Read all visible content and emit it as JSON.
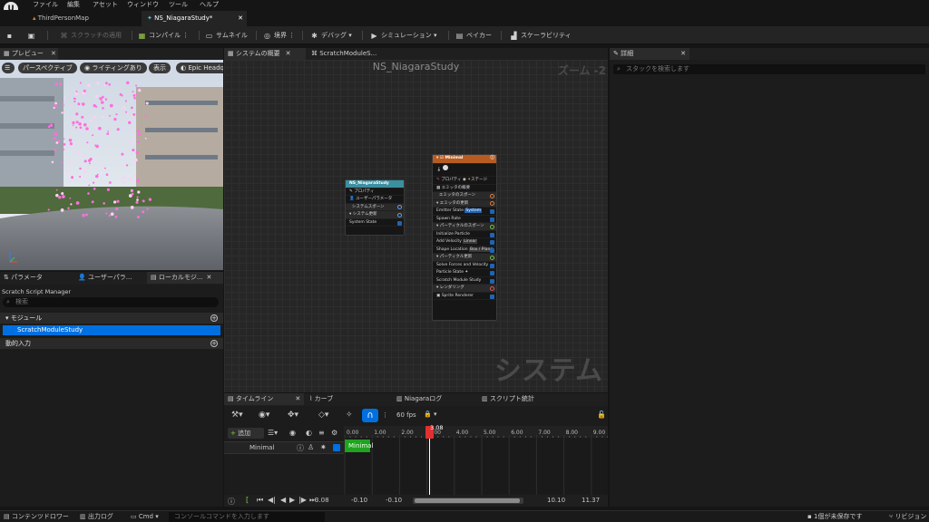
{
  "menu": [
    "ファイル",
    "編集",
    "アセット",
    "ウィンドウ",
    "ツール",
    "ヘルプ"
  ],
  "tabs": [
    {
      "label": "ThirdPersonMap"
    },
    {
      "label": "NS_NiagaraStudy*"
    }
  ],
  "toolbar": {
    "scratch": "スクラッチの適用",
    "compile": "コンパイル",
    "thumbnail": "サムネイル",
    "bounds": "境界",
    "debug": "デバッグ",
    "simulation": "シミュレーション",
    "baker": "ベイカー",
    "scalability": "スケーラビリティ"
  },
  "preview": {
    "tab": "プレビュー",
    "perspective": "パースペクティブ",
    "lighting": "ライティングあり",
    "show": "表示",
    "quality": "Epic Headq"
  },
  "graph_tabs": {
    "overview": "システムの概要",
    "scratch": "ScratchModuleS..."
  },
  "graph": {
    "title": "NS_NiagaraStudy",
    "zoom": "ズーム -2",
    "watermark": "システム",
    "system_node": {
      "title": "NS_NiagaraStudy",
      "rows": [
        "プロパティ",
        "ユーザーパラメータ",
        "システムスポーン",
        "システム更新",
        "System State"
      ]
    },
    "emitter_node": {
      "title": "Minimal",
      "header_props": "プロパティ",
      "header_stage": "ステージ",
      "rows": [
        "エミッタの概要",
        "エミッタのスポーン",
        "エミッタの更新",
        "Emitter State",
        "Spawn Rate",
        "パーティクルのスポーン",
        "Initialize Particle",
        "Add Velocity",
        "Shape Location",
        "パーティクル更新",
        "Solve Forces and Velocity",
        "Particle State",
        "Scratch Module Study",
        "レンダリング",
        "Sprite Renderer"
      ],
      "chips": {
        "system": "System",
        "linear": "Linear",
        "box": "Box / Plane"
      }
    }
  },
  "timeline": {
    "tabs": [
      "タイムライン",
      "カーブ",
      "Niagaraログ",
      "スクリプト統計"
    ],
    "fps": "60 fps",
    "add": "追加",
    "track": "Minimal",
    "clip": "Minimal",
    "playhead": "3.08",
    "ruler": [
      "0.00",
      "1.00",
      "2.00",
      "3.00",
      "4.00",
      "5.00",
      "6.00",
      "7.00",
      "8.00",
      "9.00"
    ],
    "current": "3.08",
    "range": [
      "-0.10",
      "-0.10",
      "10.10",
      "11.37"
    ]
  },
  "left_tabs": [
    "パラメータ",
    "ユーザーパラ...",
    "ローカルモジ..."
  ],
  "scratch": {
    "title": "Scratch Script Manager",
    "search": "検索",
    "modules": "モジュール",
    "item": "ScratchModuleStudy",
    "dynamic": "動的入力"
  },
  "details": {
    "tab": "詳細",
    "search": "スタックを検索します"
  },
  "status": {
    "content_drawer": "コンテンツドロワー",
    "output_log": "出力ログ",
    "cmd": "Cmd",
    "console": "コンソールコマンドを入力します",
    "unsaved": "1個が未保存です",
    "revision": "リビジョン"
  },
  "colors": {
    "accent": "#0070e0",
    "emitter_header": "#b65c22",
    "system_header": "#3a8fa0",
    "clip": "#1fa31f",
    "playhead": "#e03030"
  }
}
